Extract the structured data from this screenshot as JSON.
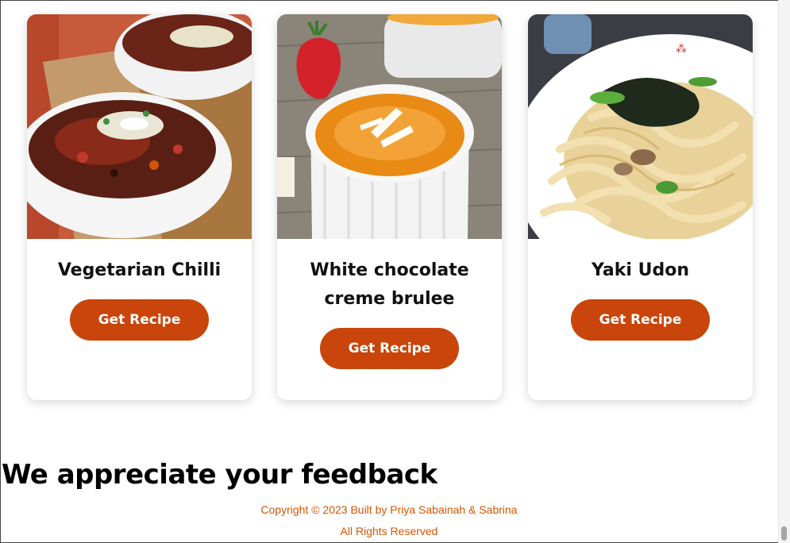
{
  "recipes": [
    {
      "title": "Vegetarian Chilli",
      "button_label": "Get Recipe",
      "image": "bowls-of-bean-chilli"
    },
    {
      "title": "White chocolate creme brulee",
      "button_label": "Get Recipe",
      "image": "creme-brulee-ramekin-with-strawberry"
    },
    {
      "title": "Yaki Udon",
      "button_label": "Get Recipe",
      "image": "plate-of-yaki-udon-noodles"
    }
  ],
  "feedback": {
    "heading": "We appreciate your feedback"
  },
  "footer": {
    "copyright": "Copyright © 2023 Built by Priya Sabainah & Sabrina",
    "rights": "All Rights Reserved"
  },
  "colors": {
    "accent": "#c9450b",
    "footer_text": "#d45500"
  }
}
